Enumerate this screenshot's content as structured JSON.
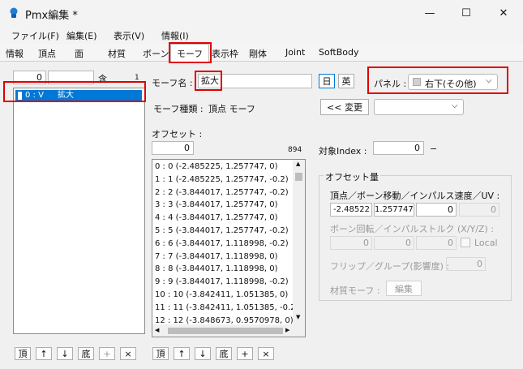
{
  "window": {
    "title": "Pmx編集 *",
    "minimize": "—",
    "maximize": "☐",
    "close": "✕"
  },
  "menu": [
    "ファイル(F)",
    "編集(E)",
    "表示(V)",
    "情報(I)"
  ],
  "tabs": [
    "情報",
    "頂点",
    "面",
    "材質",
    "ボーン",
    "モーフ",
    "表示枠",
    "剛体",
    "Joint",
    "SoftBody"
  ],
  "left_panel": {
    "index_value": "0",
    "contains_label": "含",
    "count": "1",
    "morph_list": [
      {
        "index": "0 : V",
        "name": "拡大"
      }
    ],
    "buttons": {
      "top": "頂",
      "up": "↑",
      "down": "↓",
      "bottom": "底",
      "add": "+",
      "delete": "×"
    }
  },
  "morph": {
    "name_label": "モーフ名 :",
    "name_value": "拡大",
    "lang_jp": "日",
    "lang_en": "英",
    "type_label": "モーフ種類 :",
    "type_value": "頂点 モーフ",
    "panel_label": "パネル :",
    "panel_value": "右下(その他)",
    "change_button": "<< 変更",
    "change_dropdown": ""
  },
  "offset": {
    "label": "オフセット :",
    "index_value": "0",
    "count": "894",
    "target_index_label": "対象Index :",
    "target_index_value": "0",
    "target_index_suffix": "−",
    "rows": [
      "0 : 0 (-2.485225, 1.257747, 0)",
      "1 : 1 (-2.485225, 1.257747, -0.2)",
      "2 : 2 (-3.844017, 1.257747, -0.2)",
      "3 : 3 (-3.844017, 1.257747, 0)",
      "4 : 4 (-3.844017, 1.257747, 0)",
      "5 : 5 (-3.844017, 1.257747, -0.2)",
      "6 : 6 (-3.844017, 1.118998, -0.2)",
      "7 : 7 (-3.844017, 1.118998, 0)",
      "8 : 8 (-3.844017, 1.118998, 0)",
      "9 : 9 (-3.844017, 1.118998, -0.2)",
      "10 : 10 (-3.842411, 1.051385, 0)",
      "11 : 11 (-3.842411, 1.051385, -0.2",
      "12 : 12 (-3.848673, 0.9570978, 0)"
    ],
    "buttons": {
      "top": "頂",
      "up": "↑",
      "down": "↓",
      "bottom": "底",
      "add": "+",
      "delete": "×"
    }
  },
  "offset_amount": {
    "group_label": "オフセット量",
    "vertex_label": "頂点／ボーン移動／インパルス速度／UV :",
    "vertex_values": [
      "-2.48522",
      "1.257747",
      "0",
      "0"
    ],
    "rotation_label": "ボーン回転／インパルストルク (X/Y/Z) :",
    "rotation_values": [
      "0",
      "0",
      "0"
    ],
    "local_label": "Local",
    "flip_label": "フリップ／グループ(影響度) :",
    "flip_value": "0",
    "material_label": "材質モーフ :",
    "material_button": "編集"
  },
  "colors": {
    "accent": "#0078d7",
    "highlight_border": "#e00000"
  }
}
